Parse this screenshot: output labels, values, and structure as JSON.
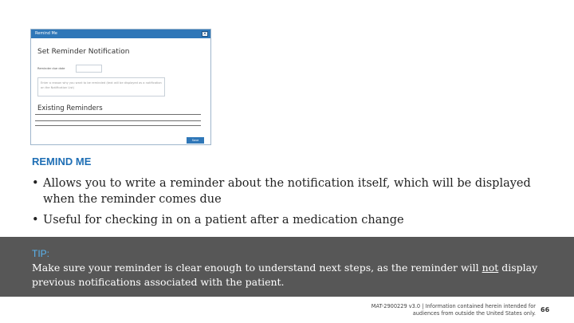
{
  "dialog": {
    "title": "Remind Me",
    "close_glyph": "✕",
    "heading": "Set Reminder Notification",
    "field_label": "Reminder due date",
    "textarea_placeholder": "Enter a reason why you want to be reminded (text will be displayed as a notification on the Notification List)",
    "existing_heading": "Existing Reminders",
    "button_label": "Save"
  },
  "slide": {
    "section_title": "REMIND ME",
    "bullet_mark": "•",
    "bullets": [
      "Allows you to write a reminder about the notification itself, which will be displayed when the reminder comes due",
      "Useful for checking in on a patient after a medication change"
    ]
  },
  "tip": {
    "label": "TIP:",
    "text_before": "Make sure your reminder is clear enough to understand next steps, as the reminder will ",
    "emphasis": "not",
    "text_after": " display previous notifications associated with the patient."
  },
  "footer": {
    "note": "MAT-2900229 v3.0 | Information contained herein intended for audiences from outside the United States only.",
    "page_number": "66"
  },
  "colors": {
    "titlebar": "#2f77b8",
    "section_title": "#1f6fb5",
    "tip_band": "#575757",
    "tip_label": "#5ab4f0"
  }
}
